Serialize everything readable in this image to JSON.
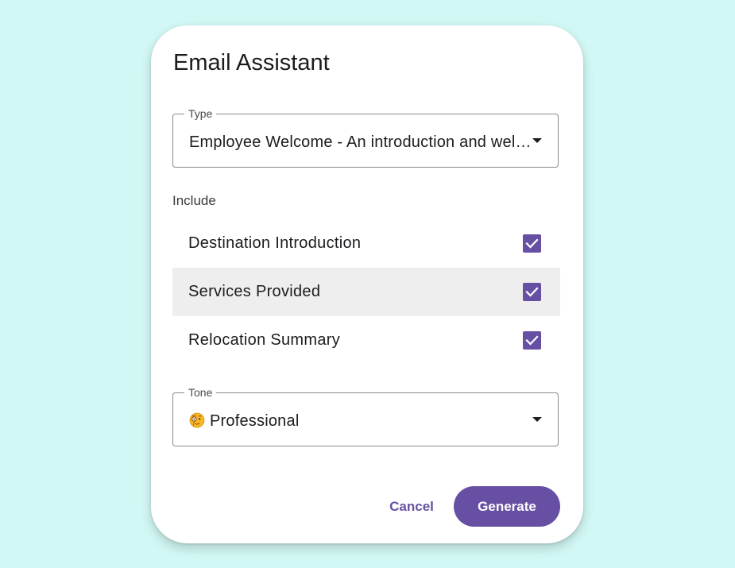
{
  "dialog": {
    "title": "Email Assistant"
  },
  "type_field": {
    "label": "Type",
    "value": "Employee Welcome - An introduction and welcome email for the employee"
  },
  "include": {
    "label": "Include",
    "items": [
      {
        "label": "Destination Introduction",
        "checked": true
      },
      {
        "label": "Services Provided",
        "checked": true
      },
      {
        "label": "Relocation Summary",
        "checked": true
      }
    ]
  },
  "tone_field": {
    "label": "Tone",
    "icon": "monocle-face-emoji",
    "value": "Professional"
  },
  "actions": {
    "cancel_label": "Cancel",
    "generate_label": "Generate"
  },
  "colors": {
    "accent": "#6750a4",
    "background": "#d2f8f5",
    "hover_row": "#eeeeee"
  }
}
